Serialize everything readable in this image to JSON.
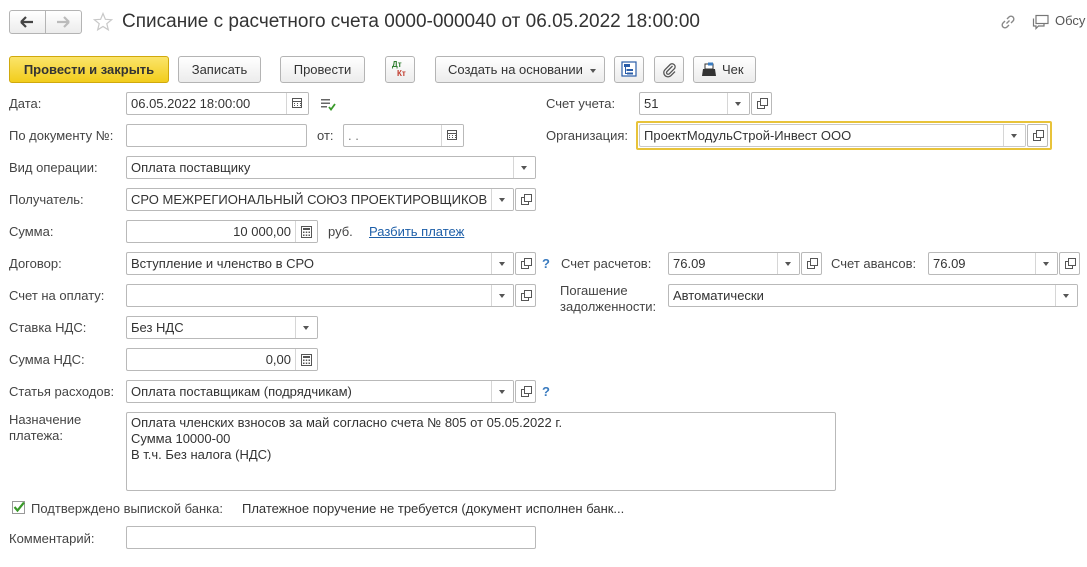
{
  "header": {
    "title": "Списание с расчетного счета 0000-000040 от 06.05.2022 18:00:00",
    "discuss_label": "Обсу"
  },
  "toolbar": {
    "post_close": "Провести и закрыть",
    "save": "Записать",
    "post": "Провести",
    "dt_kt_top": "Дт",
    "dt_kt_bottom": "Кт",
    "create_based": "Создать на основании",
    "receipt": "Чек"
  },
  "form": {
    "date_label": "Дата:",
    "date_value": "06.05.2022 18:00:00",
    "by_doc_label": "По документу №:",
    "by_doc_value": "",
    "from_label": "от:",
    "from_value": " .  .",
    "op_type_label": "Вид операции:",
    "op_type_value": "Оплата поставщику",
    "recipient_label": "Получатель:",
    "recipient_value": "СРО МЕЖРЕГИОНАЛЬНЫЙ СОЮЗ ПРОЕКТИРОВЩИКОВ",
    "amount_label": "Сумма:",
    "amount_value": "10 000,00",
    "currency": "руб.",
    "split_payment": "Разбить платеж",
    "contract_label": "Договор:",
    "contract_value": "Вступление и членство в СРО",
    "invoice_label": "Счет на оплату:",
    "invoice_value": "",
    "vat_rate_label": "Ставка НДС:",
    "vat_rate_value": "Без НДС",
    "vat_amount_label": "Сумма НДС:",
    "vat_amount_value": "0,00",
    "expense_label": "Статья расходов:",
    "expense_value": "Оплата поставщикам (подрядчикам)",
    "purpose_label_1": "Назначение",
    "purpose_label_2": "платежа:",
    "purpose_value": "Оплата членских взносов за май согласно счета № 805 от 05.05.2022 г.\nСумма 10000-00\nВ т.ч. Без налога (НДС)",
    "confirmed_label": "Подтверждено выпиской банка:",
    "payment_order_text": "Платежное поручение не требуется (документ исполнен банк...",
    "comment_label": "Комментарий:",
    "comment_value": "",
    "account_label": "Счет учета:",
    "account_value": "51",
    "org_label": "Организация:",
    "org_value": "ПроектМодульСтрой-Инвест ООО",
    "settle_label": "Счет расчетов:",
    "settle_value": "76.09",
    "advance_label": "Счет авансов:",
    "advance_value": "76.09",
    "repay_label_1": "Погашение",
    "repay_label_2": "задолженности:",
    "repay_value": "Автоматически",
    "help_mark": "?"
  },
  "colors": {
    "primary_button": "#f2cd1c",
    "focus_border": "#e8c33a",
    "link": "#1e5fa8",
    "check": "#3a9a2a"
  }
}
